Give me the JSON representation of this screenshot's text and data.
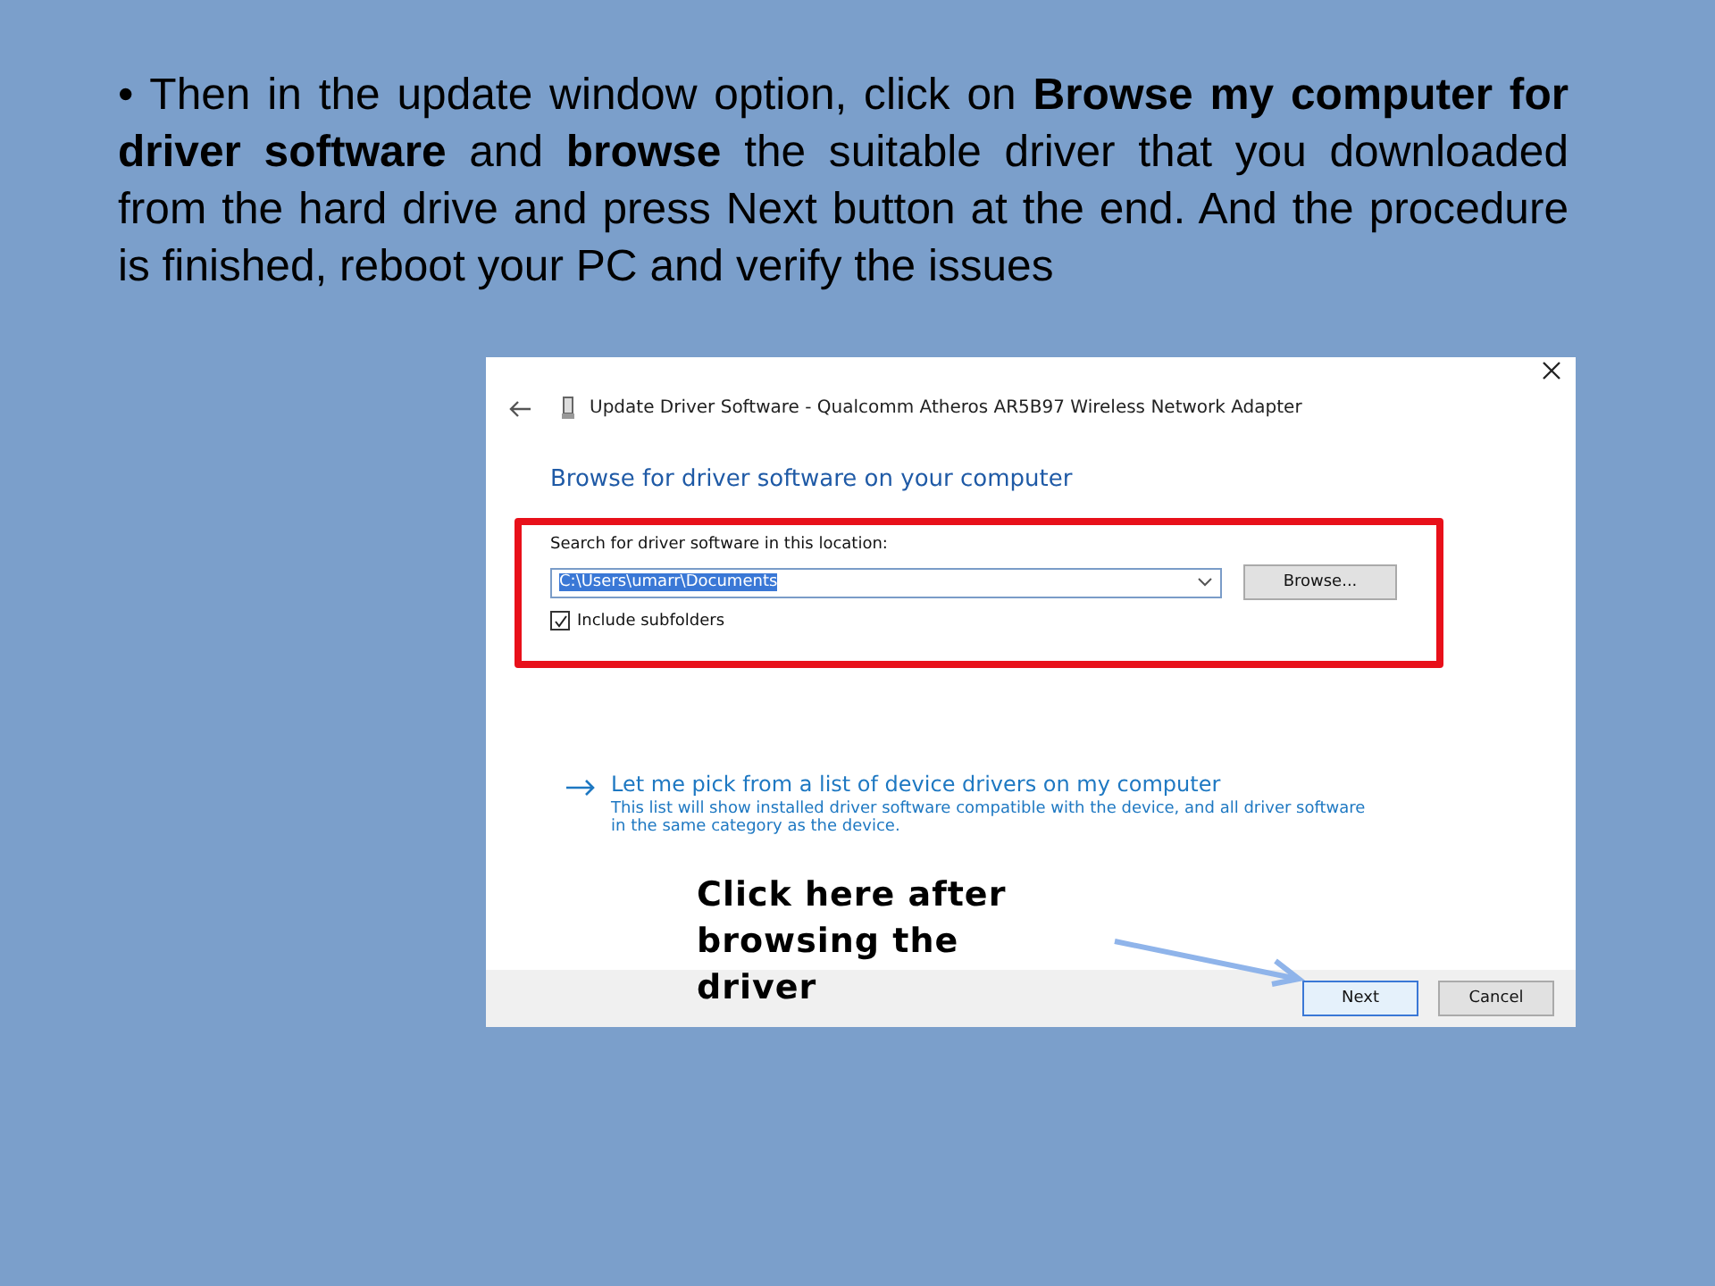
{
  "slide": {
    "paragraph": "• Then in the update window option, click on **Browse my computer for driver software** and **browse** the suitable driver that you downloaded from the hard drive and press Next button at the end. And the procedure is finished, reboot your PC and verify the issues"
  },
  "dialog": {
    "title": "Update Driver Software - Qualcomm Atheros AR5B97 Wireless Network Adapter",
    "heading": "Browse for driver software on your computer",
    "location_label": "Search for driver software in this location:",
    "location_value": "C:\\Users\\umarr\\Documents",
    "value_selected": true,
    "browse_button": "Browse...",
    "include_subfolders": {
      "label": "Include subfolders",
      "checked": true
    },
    "pick_link": {
      "title": "Let me pick from a list of device drivers on my computer",
      "description": "This list will show installed driver software compatible with the device, and all driver software in the same category as the device."
    },
    "annotation": "Click here after browsing the driver",
    "buttons": [
      {
        "label": "Next",
        "default": true
      },
      {
        "label": "Cancel",
        "default": false
      }
    ]
  }
}
